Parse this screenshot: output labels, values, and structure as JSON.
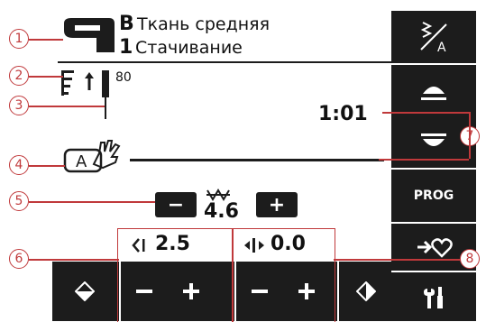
{
  "header": {
    "fabric_letter": "B",
    "fabric_name": "Ткань средняя",
    "program_number": "1",
    "program_name": "Стачивание"
  },
  "indicators": {
    "presser_value": "80",
    "time": "1:01"
  },
  "stitch_width": {
    "value": "4.6",
    "minus": "−",
    "plus": "+"
  },
  "stitch_length": {
    "value": "2.5"
  },
  "stitch_position": {
    "value": "0.0"
  },
  "right_panel": {
    "prog_label": "PROG"
  },
  "callouts": [
    "1",
    "2",
    "3",
    "4",
    "5",
    "6",
    "7",
    "8"
  ],
  "colors": {
    "panel": "#1c1c1c",
    "callout": "#c0393b"
  }
}
